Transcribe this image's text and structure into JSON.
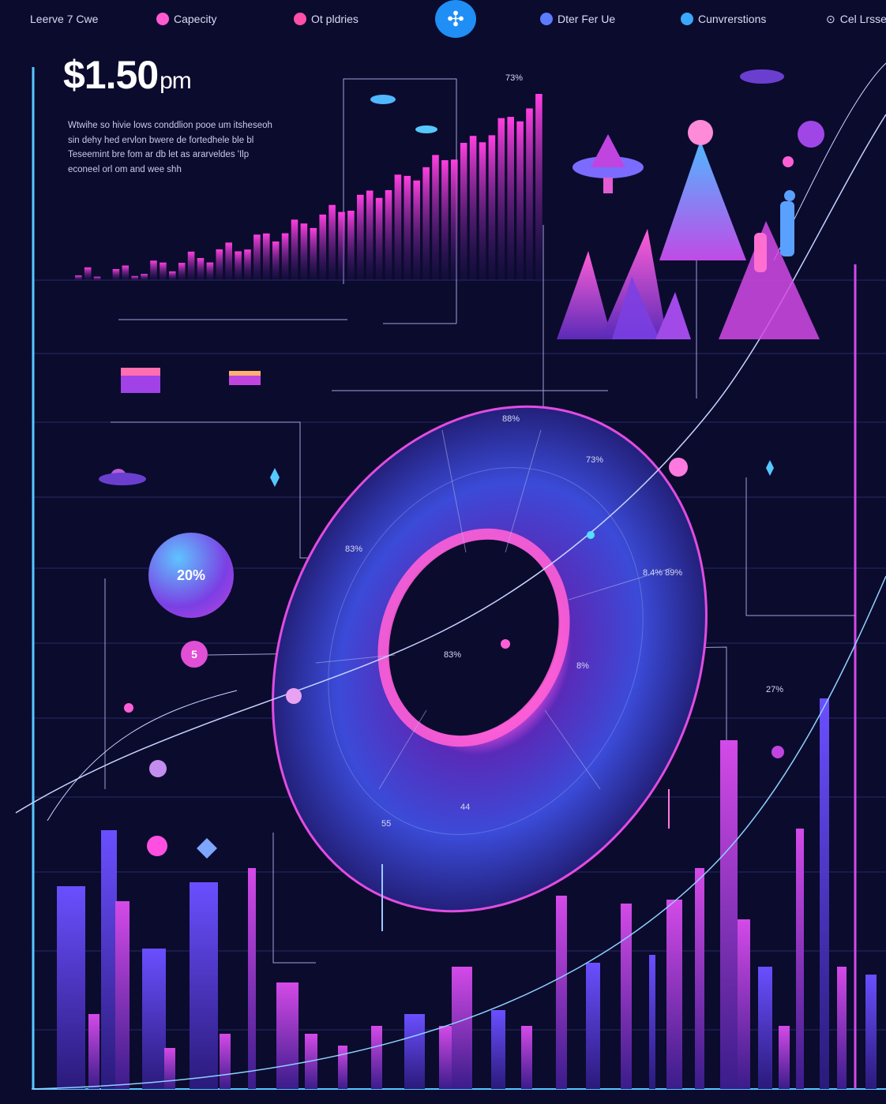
{
  "nav": {
    "items": [
      {
        "label": "Leerve 7 Cwe",
        "dot_color": ""
      },
      {
        "label": "Capecity",
        "dot_color": "#ff5ad0"
      },
      {
        "label": "Ot pldries",
        "dot_color": "#ff4fa8"
      },
      {
        "label": "Dter Fer Ue",
        "dot_color": "#5b7cff"
      },
      {
        "label": "Cunvrerstions",
        "dot_color": "#3aa8ff"
      },
      {
        "label": "Cel Lrsse",
        "dot_color": ""
      }
    ],
    "hub_icon": "cross-hub-icon"
  },
  "headline": {
    "price": "$1.50",
    "unit": "pm"
  },
  "description": "Wtwihe so hivie lows conddlion pooe um itsheseoh sin dehy hed ervlon bwere de fortedhele ble bl Teseemint bre fom ar db let as ararveldes 'Ilp econeel orl om and wee shh",
  "badges": {
    "big_bubble": "20%",
    "small_bubble": "5"
  },
  "labels": {
    "top": "73%",
    "ring_top": "88%",
    "ring_upper": "73%",
    "ring_left": "83%",
    "ring_right": "8.4% 89%",
    "ring_center": "83%",
    "ring_inner_right": "8%",
    "ring_lower_left": "55",
    "ring_lower": "44",
    "right_mid": "27%"
  },
  "colors": {
    "background": "#0b0b2e",
    "magenta": "#d44ae8",
    "pink": "#ff5fd6",
    "blue": "#3d6cff",
    "cyan": "#55c8ff",
    "purple": "#7b3fe4"
  }
}
